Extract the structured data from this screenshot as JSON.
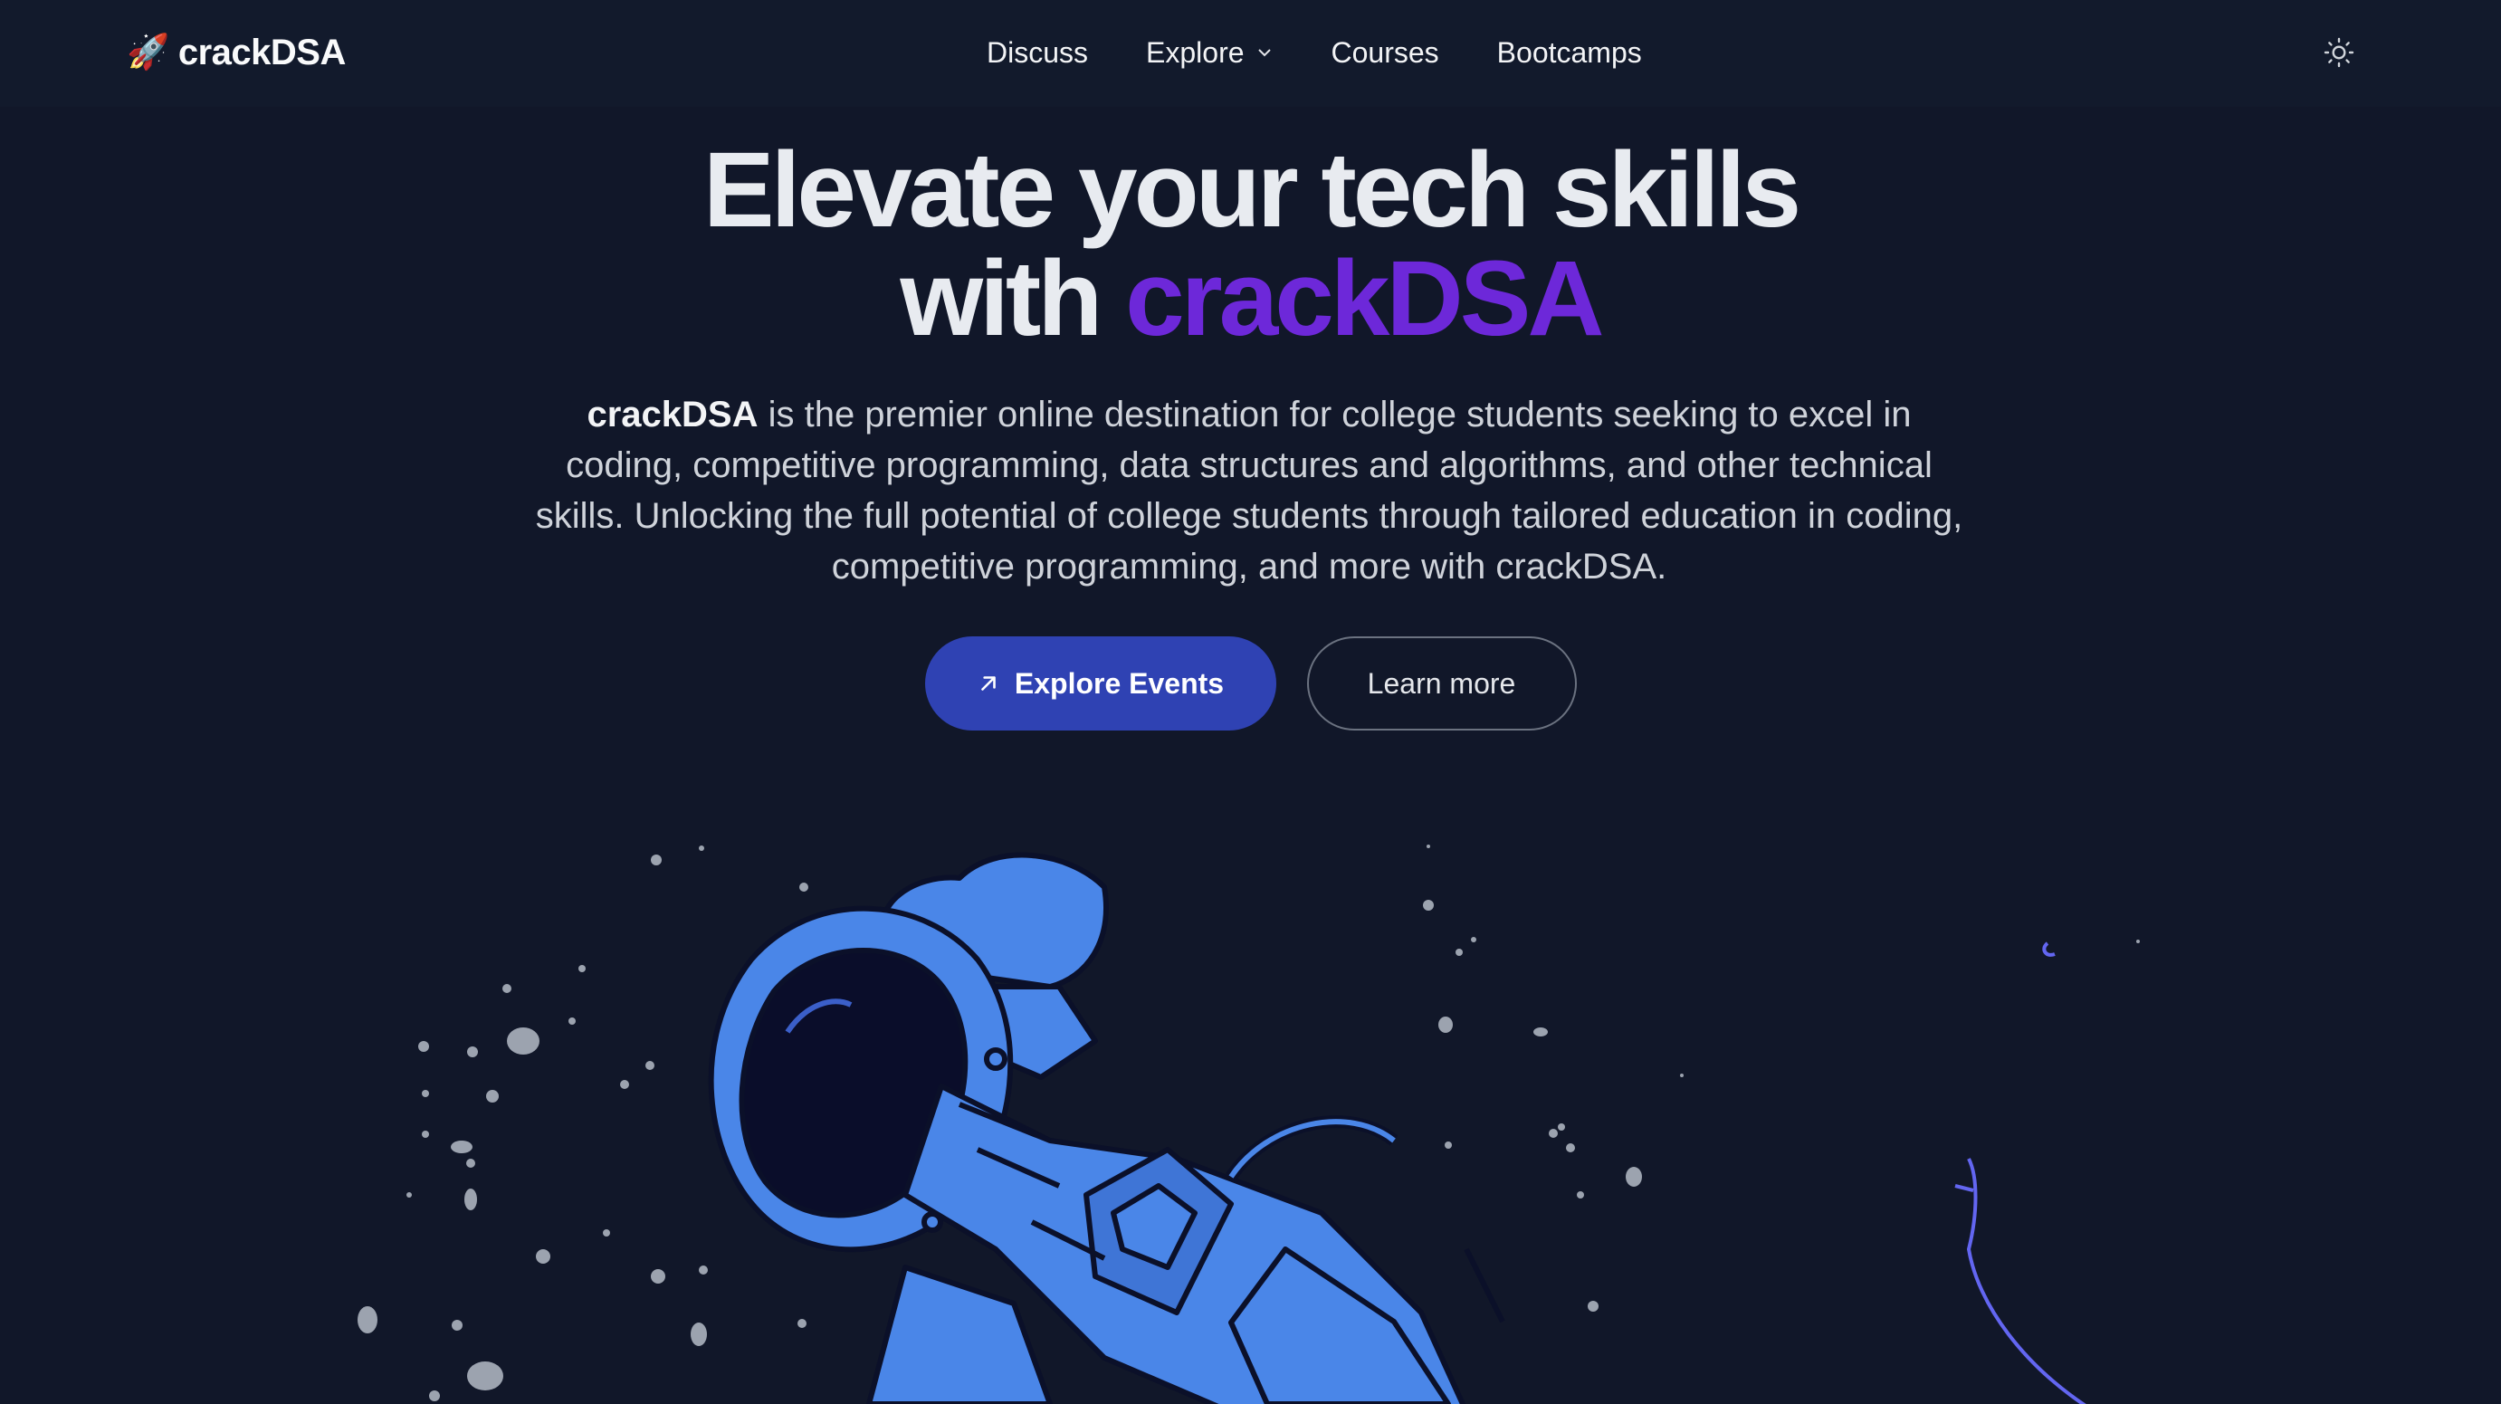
{
  "navbar": {
    "brand_icon": "rocket-icon",
    "brand_name": "crackDSA",
    "links": [
      {
        "label": "Discuss"
      },
      {
        "label": "Explore",
        "has_dropdown": true
      },
      {
        "label": "Courses"
      },
      {
        "label": "Bootcamps"
      }
    ],
    "theme_toggle_icon": "sun-icon"
  },
  "hero": {
    "title_line1": "Elevate your tech skills",
    "title_line2_prefix": "with ",
    "title_line2_accent": "crackDSA",
    "description_brand": "crackDSA",
    "description_text": " is the premier online destination for college students seeking to excel in coding, competitive programming, data structures and algorithms, and other technical skills. Unlocking the full potential of college students through tailored education in coding, competitive programming, and more with crackDSA.",
    "primary_button": {
      "label": "Explore Events",
      "icon": "arrow-up-right-icon"
    },
    "secondary_button": {
      "label": "Learn more"
    }
  },
  "colors": {
    "background": "#111729",
    "accent": "#6d28d9",
    "primary_button": "#2f42b3",
    "astronaut": "#4a86e8"
  },
  "illustration": {
    "subject": "floating-astronaut"
  }
}
